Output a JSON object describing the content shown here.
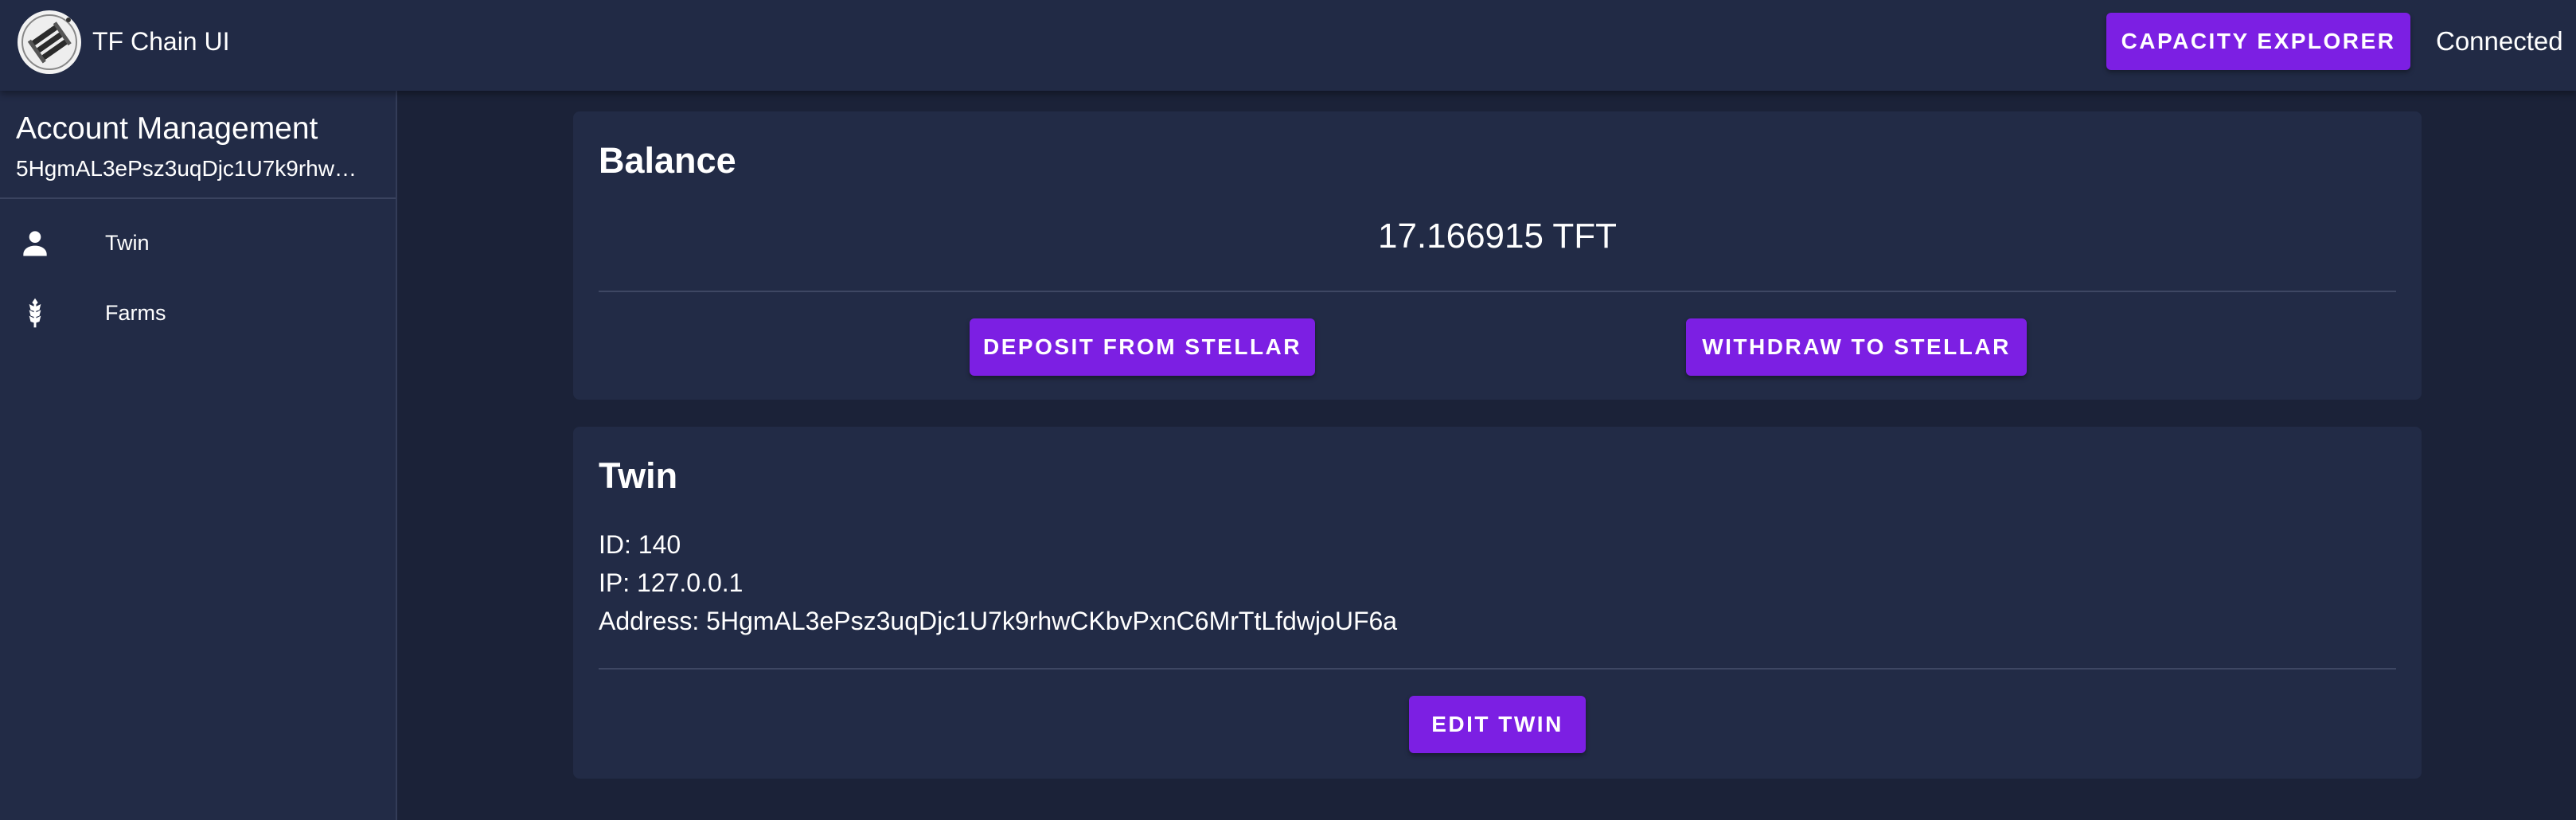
{
  "header": {
    "app_title": "TF Chain UI",
    "capacity_explorer_label": "Capacity Explorer",
    "connection_status": "Connected"
  },
  "sidebar": {
    "title": "Account Management",
    "address": "5HgmAL3ePsz3uqDjc1U7k9rhwCKbvPxnC6MrTtLfdwjoUF6a",
    "items": [
      {
        "label": "Twin",
        "icon": "person-icon"
      },
      {
        "label": "Farms",
        "icon": "wheat-icon"
      }
    ]
  },
  "balance_card": {
    "title": "Balance",
    "amount": "17.166915 TFT",
    "deposit_label": "Deposit from Stellar",
    "withdraw_label": "Withdraw to Stellar"
  },
  "twin_card": {
    "title": "Twin",
    "id_line": "ID: 140",
    "ip_line": "IP: 127.0.0.1",
    "address_line": "Address: 5HgmAL3ePsz3uqDjc1U7k9rhwCKbvPxnC6MrTtLfdwjoUF6a",
    "edit_label": "Edit Twin"
  },
  "colors": {
    "accent": "#7c1fe3",
    "background": "#1b2238",
    "surface": "#222b46"
  }
}
